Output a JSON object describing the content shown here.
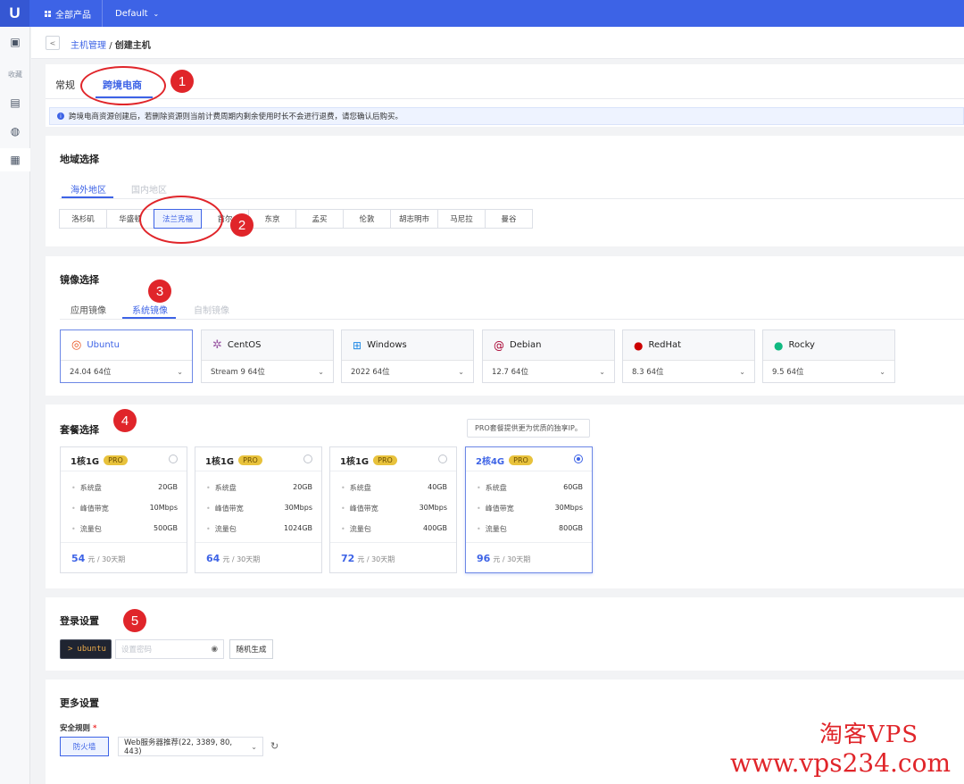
{
  "topbar": {
    "logo": "U",
    "all_products": "全部产品",
    "project": "Default"
  },
  "sidebar": {
    "fav_label": "收藏"
  },
  "breadcrumb": {
    "parent": "主机管理",
    "separator": "/",
    "current": "创建主机"
  },
  "main_tabs": [
    {
      "label": "常规"
    },
    {
      "label": "跨境电商"
    }
  ],
  "notice": "跨境电商资源创建后，若删除资源则当前计费周期内剩余使用时长不会进行退费，请您确认后购买。",
  "region": {
    "title": "地域选择",
    "tabs": [
      "海外地区",
      "国内地区"
    ],
    "items": [
      "洛杉矶",
      "华盛顿",
      "法兰克福",
      "首尔",
      "东京",
      "孟买",
      "伦敦",
      "胡志明市",
      "马尼拉",
      "曼谷"
    ]
  },
  "image": {
    "title": "镜像选择",
    "tabs": [
      "应用镜像",
      "系统镜像",
      "自制镜像"
    ],
    "os": [
      {
        "name": "Ubuntu",
        "version": "24.04 64位"
      },
      {
        "name": "CentOS",
        "version": "Stream 9 64位"
      },
      {
        "name": "Windows",
        "version": "2022 64位"
      },
      {
        "name": "Debian",
        "version": "12.7 64位"
      },
      {
        "name": "RedHat",
        "version": "8.3 64位"
      },
      {
        "name": "Rocky",
        "version": "9.5 64位"
      }
    ]
  },
  "package": {
    "title": "套餐选择",
    "tooltip": "PRO套餐提供更为优质的独享IP。",
    "pro_badge": "PRO",
    "spec_labels": [
      "系统盘",
      "峰值带宽",
      "流量包"
    ],
    "price_unit": "元 / 30天期",
    "items": [
      {
        "name": "1核1G",
        "disk": "20GB",
        "bandwidth": "10Mbps",
        "traffic": "500GB",
        "price": "54"
      },
      {
        "name": "1核1G",
        "disk": "20GB",
        "bandwidth": "30Mbps",
        "traffic": "1024GB",
        "price": "64"
      },
      {
        "name": "1核1G",
        "disk": "40GB",
        "bandwidth": "30Mbps",
        "traffic": "400GB",
        "price": "72"
      },
      {
        "name": "2核4G",
        "disk": "60GB",
        "bandwidth": "30Mbps",
        "traffic": "800GB",
        "price": "96"
      }
    ]
  },
  "login": {
    "title": "登录设置",
    "user_prefix": ">",
    "user": "ubuntu",
    "pwd_placeholder": "设置密码",
    "random_btn": "随机生成"
  },
  "more": {
    "title": "更多设置",
    "rule_label": "安全规则",
    "required": "*",
    "firewall_btn": "防火墙",
    "rule_value": "Web服务器推荐(22, 3389, 80, 443)"
  },
  "annotations": [
    "1",
    "2",
    "3",
    "4",
    "5"
  ],
  "watermark": {
    "line1": "淘客VPS",
    "line2": "www.vps234.com"
  }
}
